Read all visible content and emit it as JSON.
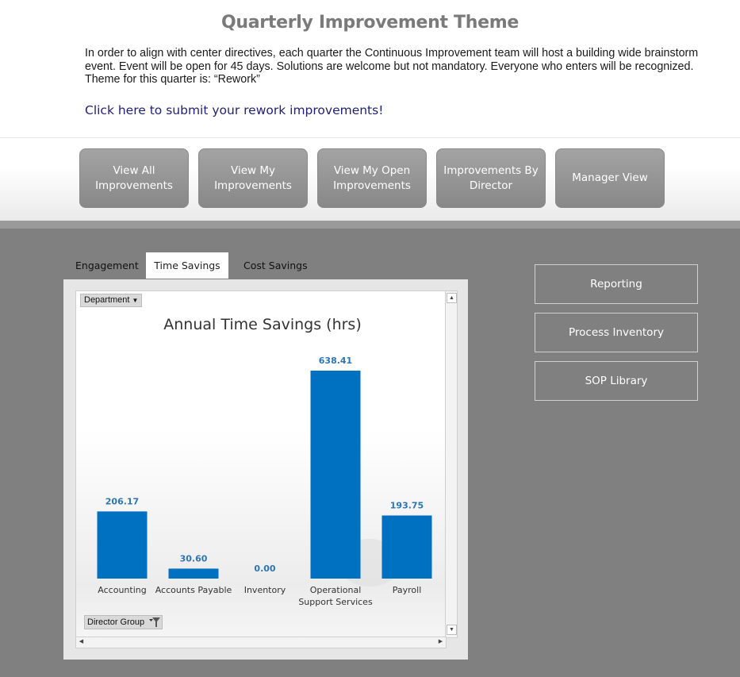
{
  "header": {
    "title": "Quarterly Improvement Theme",
    "description": "In order to align with center directives, each quarter the Continuous Improvement team will host a building wide brainstorm event. Event will be open for 45 days. Solutions are welcome but not mandatory. Everyone who enters will be recognized. Theme for this quarter is: “Rework”",
    "submit_link": "Click here to submit your rework improvements!"
  },
  "nav": {
    "buttons": [
      {
        "label": "View All Improvements"
      },
      {
        "label": "View My Improvements"
      },
      {
        "label": "View My Open Improvements"
      },
      {
        "label": "Improvements By Director"
      },
      {
        "label": "Manager View"
      }
    ]
  },
  "tabs": [
    {
      "label": "Engagement"
    },
    {
      "label": "Time Savings",
      "active": true
    },
    {
      "label": "Cost Savings"
    }
  ],
  "filters": {
    "department": "Department",
    "director_group": "Director Group"
  },
  "side_buttons": [
    {
      "label": "Reporting"
    },
    {
      "label": "Process Inventory"
    },
    {
      "label": "SOP Library"
    }
  ],
  "colors": {
    "bar": "#0070c0",
    "value_label": "#2e75b6"
  },
  "chart_data": {
    "type": "bar",
    "title": "Annual Time Savings (hrs)",
    "categories": [
      "Accounting",
      "Accounts Payable",
      "Inventory",
      "Operational Support Services",
      "Payroll"
    ],
    "category_lines": [
      [
        "Accounting"
      ],
      [
        "Accounts Payable"
      ],
      [
        "Inventory"
      ],
      [
        "Operational",
        "Support Services"
      ],
      [
        "Payroll"
      ]
    ],
    "values": [
      206.17,
      30.6,
      0.0,
      638.41,
      193.75
    ],
    "value_labels": [
      "206.17",
      "30.60",
      "0.00",
      "638.41",
      "193.75"
    ],
    "ylim": [
      0,
      638.41
    ],
    "grid": false
  }
}
